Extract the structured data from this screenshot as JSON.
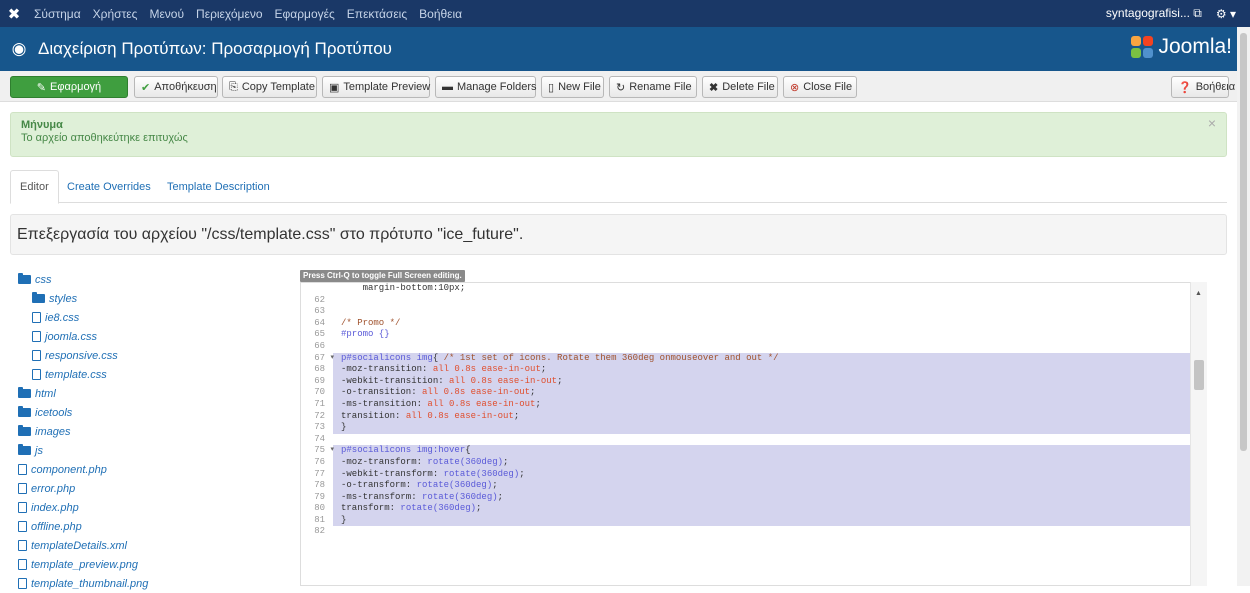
{
  "topbar": {
    "menu": [
      "Σύστημα",
      "Χρήστες",
      "Μενού",
      "Περιεχόμενο",
      "Εφαρμογές",
      "Επεκτάσεις",
      "Βοήθεια"
    ],
    "user": "syntagografisi...",
    "external_icon": "external-link-icon",
    "gear_icon": "gear-icon"
  },
  "header": {
    "title": "Διαχείριση Προτύπων: Προσαρμογή Προτύπου",
    "brand": "Joomla!"
  },
  "toolbar": {
    "apply": "Εφαρμογή",
    "save": "Αποθήκευση",
    "copy_template": "Copy Template",
    "template_preview": "Template Preview",
    "manage_folders": "Manage Folders",
    "new_file": "New File",
    "rename_file": "Rename File",
    "delete_file": "Delete File",
    "close_file": "Close File",
    "help": "Βοήθεια"
  },
  "alert": {
    "heading": "Μήνυμα",
    "message": "Το αρχείο αποθηκεύτηκε επιτυχώς"
  },
  "tabs": [
    "Editor",
    "Create Overrides",
    "Template Description"
  ],
  "edit_title": "Επεξεργασία του αρχείου \"/css/template.css\" στο πρότυπο \"ice_future\".",
  "tree": [
    {
      "name": "css",
      "type": "folder",
      "level": 0
    },
    {
      "name": "styles",
      "type": "folder",
      "level": 1
    },
    {
      "name": "ie8.css",
      "type": "file",
      "level": 1
    },
    {
      "name": "joomla.css",
      "type": "file",
      "level": 1
    },
    {
      "name": "responsive.css",
      "type": "file",
      "level": 1
    },
    {
      "name": "template.css",
      "type": "file",
      "level": 1
    },
    {
      "name": "html",
      "type": "folder",
      "level": 0
    },
    {
      "name": "icetools",
      "type": "folder",
      "level": 0
    },
    {
      "name": "images",
      "type": "folder",
      "level": 0
    },
    {
      "name": "js",
      "type": "folder",
      "level": 0
    },
    {
      "name": "component.php",
      "type": "file",
      "level": 0
    },
    {
      "name": "error.php",
      "type": "file",
      "level": 0
    },
    {
      "name": "index.php",
      "type": "file",
      "level": 0
    },
    {
      "name": "offline.php",
      "type": "file",
      "level": 0
    },
    {
      "name": "templateDetails.xml",
      "type": "file",
      "level": 0
    },
    {
      "name": "template_preview.png",
      "type": "file",
      "level": 0
    },
    {
      "name": "template_thumbnail.png",
      "type": "file",
      "level": 0
    }
  ],
  "editor": {
    "tooltip": "Press Ctrl-Q to toggle Full Screen editing.",
    "lines": [
      {
        "n": "",
        "code": "    margin-bottom:10px;",
        "sel": false
      },
      {
        "n": "62",
        "code": "",
        "sel": false
      },
      {
        "n": "63",
        "code": "",
        "sel": false
      },
      {
        "n": "64",
        "code": "/* Promo */",
        "sel": false,
        "style": "comment"
      },
      {
        "n": "65",
        "code": "#promo {}",
        "sel": false,
        "style": "selector"
      },
      {
        "n": "66",
        "code": "",
        "sel": false
      },
      {
        "n": "67",
        "code": "p#socialicons img{ /* 1st set of icons. Rotate them 360deg onmouseover and out */",
        "sel": true,
        "fold": true
      },
      {
        "n": "68",
        "code": "-moz-transition: all 0.8s ease-in-out;",
        "sel": true
      },
      {
        "n": "69",
        "code": "-webkit-transition: all 0.8s ease-in-out;",
        "sel": true
      },
      {
        "n": "70",
        "code": "-o-transition: all 0.8s ease-in-out;",
        "sel": true
      },
      {
        "n": "71",
        "code": "-ms-transition: all 0.8s ease-in-out;",
        "sel": true
      },
      {
        "n": "72",
        "code": "transition: all 0.8s ease-in-out;",
        "sel": true
      },
      {
        "n": "73",
        "code": "}",
        "sel": true
      },
      {
        "n": "74",
        "code": "",
        "sel": false
      },
      {
        "n": "75",
        "code": "p#socialicons img:hover{",
        "sel": true,
        "fold": true
      },
      {
        "n": "76",
        "code": "-moz-transform: rotate(360deg);",
        "sel": true
      },
      {
        "n": "77",
        "code": "-webkit-transform: rotate(360deg);",
        "sel": true
      },
      {
        "n": "78",
        "code": "-o-transform: rotate(360deg);",
        "sel": true
      },
      {
        "n": "79",
        "code": "-ms-transform: rotate(360deg);",
        "sel": true
      },
      {
        "n": "80",
        "code": "transform: rotate(360deg);",
        "sel": true
      },
      {
        "n": "81",
        "code": "}",
        "sel": true
      },
      {
        "n": "82",
        "code": "",
        "sel": false
      }
    ]
  }
}
